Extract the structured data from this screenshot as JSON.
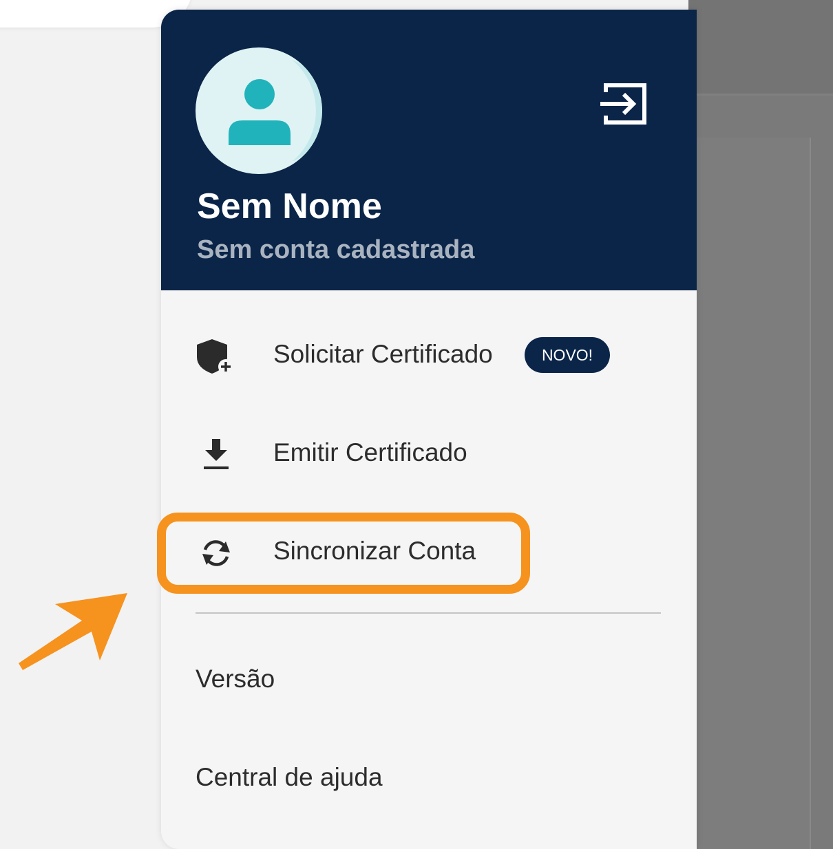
{
  "colors": {
    "header_bg": "#0b2549",
    "drawer_bg": "#f5f5f5",
    "accent_highlight": "#f6921e",
    "avatar_bg": "#dff3f4",
    "avatar_figure": "#21b3bb",
    "badge_bg": "#0b2549"
  },
  "profile": {
    "name": "Sem Nome",
    "subtitle": "Sem conta cadastrada",
    "avatar_icon": "user-icon",
    "logout_icon": "login-exit-icon"
  },
  "menu": {
    "items": [
      {
        "label": "Solicitar Certificado",
        "icon": "shield-plus-icon",
        "badge": "NOVO!"
      },
      {
        "label": "Emitir Certificado",
        "icon": "download-icon"
      },
      {
        "label": "Sincronizar Conta",
        "icon": "sync-icon",
        "highlighted": true
      }
    ],
    "links": [
      {
        "label": "Versão"
      },
      {
        "label": "Central de ajuda"
      }
    ]
  },
  "annotation": {
    "arrow_icon": "arrow-icon"
  }
}
